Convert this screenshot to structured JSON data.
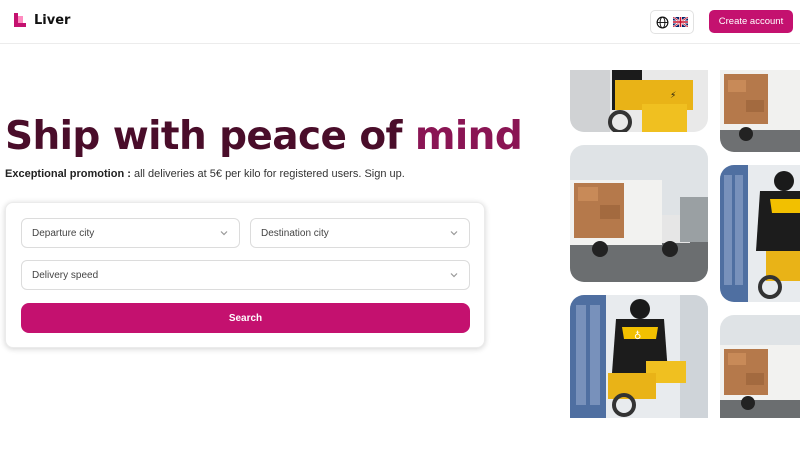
{
  "header": {
    "brand": "Liver",
    "language_icon": "globe-icon",
    "flag_icon": "uk-flag-icon",
    "create_account_label": "Create account"
  },
  "hero": {
    "headline_part1": "Ship with peace of ",
    "headline_part2": "mind",
    "promo_bold": "Exceptional promotion :",
    "promo_text": " all deliveries at 5€ per kilo for registered users. Sign up."
  },
  "search_form": {
    "departure_placeholder": "Departure city",
    "destination_placeholder": "Destination city",
    "speed_placeholder": "Delivery speed",
    "search_label": "Search"
  },
  "gallery": {
    "images": [
      "courier-scooter-photo",
      "delivery-truck-photo",
      "courier-scooter-photo",
      "delivery-truck-photo",
      "courier-scooter-photo",
      "delivery-truck-photo"
    ]
  },
  "colors": {
    "brand": "#c4116f",
    "headline_dark": "#4a0d2a",
    "headline_accent": "#8a1554"
  }
}
